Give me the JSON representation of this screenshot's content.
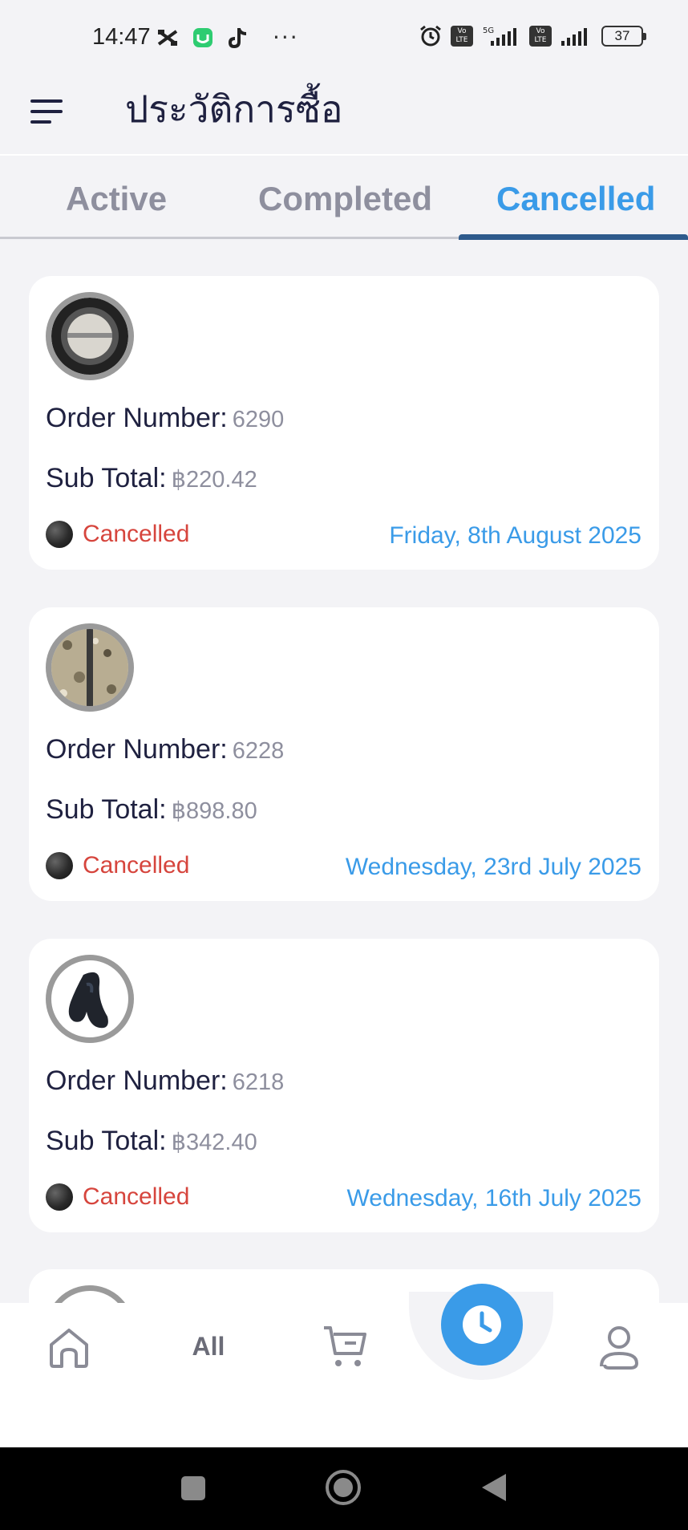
{
  "status_bar": {
    "time": "14:47",
    "more": "···",
    "battery": "37",
    "network": "5G",
    "lte_badge": "Vo LTE"
  },
  "header": {
    "title": "ประวัติการซื้อ"
  },
  "tabs": [
    {
      "label": "Active",
      "active": false
    },
    {
      "label": "Completed",
      "active": false
    },
    {
      "label": "Cancelled",
      "active": true
    }
  ],
  "labels": {
    "order_number": "Order Number:",
    "sub_total": "Sub Total:"
  },
  "orders": [
    {
      "order_number": "6290",
      "sub_total": "฿220.42",
      "status": "Cancelled",
      "date": "Friday, 8th August 2025",
      "image": "round-device-thumbnail"
    },
    {
      "order_number": "6228",
      "sub_total": "฿898.80",
      "status": "Cancelled",
      "date": "Wednesday, 23rd July 2025",
      "image": "stone-panel-thumbnail"
    },
    {
      "order_number": "6218",
      "sub_total": "฿342.40",
      "status": "Cancelled",
      "date": "Wednesday, 16th July 2025",
      "image": "dark-knot-thumbnail"
    }
  ],
  "bottom_nav": {
    "items": [
      "home-icon",
      "All",
      "cart-icon",
      "history-icon",
      "profile-icon"
    ],
    "all_label": "All",
    "active": "history"
  },
  "colors": {
    "accent": "#3a9be8",
    "cancelled": "#d6453d",
    "indicator": "#2e5a8c",
    "background": "#f3f3f6"
  }
}
